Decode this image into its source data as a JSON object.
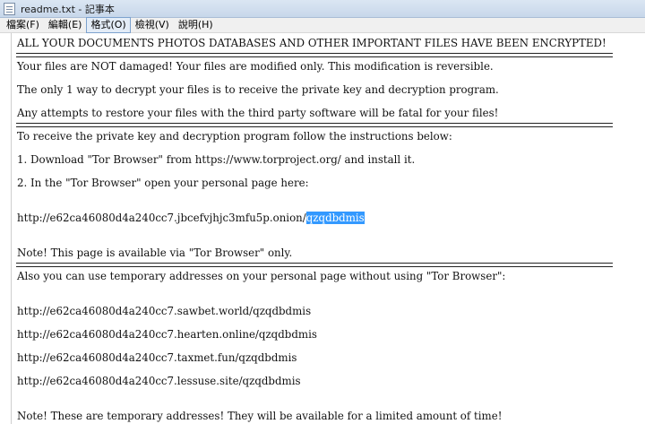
{
  "window": {
    "title": "readme.txt - 記事本"
  },
  "menu": [
    "檔案(F)",
    "編輯(E)",
    "格式(O)",
    "檢視(V)",
    "說明(H)"
  ],
  "content": {
    "header": "ALL YOUR DOCUMENTS PHOTOS DATABASES AND OTHER IMPORTANT FILES HAVE BEEN ENCRYPTED!",
    "p1": "Your files are NOT damaged! Your files are modified only. This modification is reversible.",
    "p2": "The only 1 way to decrypt your files is to receive the private key and decryption program.",
    "p3": "Any attempts to restore your files with the third party software will be fatal for your files!",
    "instr_intro": "To receive the private key and decryption program follow the instructions below:",
    "step1": "1. Download \"Tor Browser\" from https://www.torproject.org/ and install it.",
    "step2": "2. In the \"Tor Browser\" open your personal page here:",
    "onion_prefix": "http://e62ca46080d4a240cc7.jbcefvjhjc3mfu5p.onion/",
    "onion_selected": "qzqdbdmis",
    "note1": "Note! This page is available via \"Tor Browser\" only.",
    "temp_intro": "Also you can use temporary addresses on your personal page without using \"Tor Browser\":",
    "temp_urls": [
      "http://e62ca46080d4a240cc7.sawbet.world/qzqdbdmis",
      "http://e62ca46080d4a240cc7.hearten.online/qzqdbdmis",
      "http://e62ca46080d4a240cc7.taxmet.fun/qzqdbdmis",
      "http://e62ca46080d4a240cc7.lessuse.site/qzqdbdmis"
    ],
    "note2": "Note! These are temporary addresses! They will be available for a limited amount of time!"
  }
}
